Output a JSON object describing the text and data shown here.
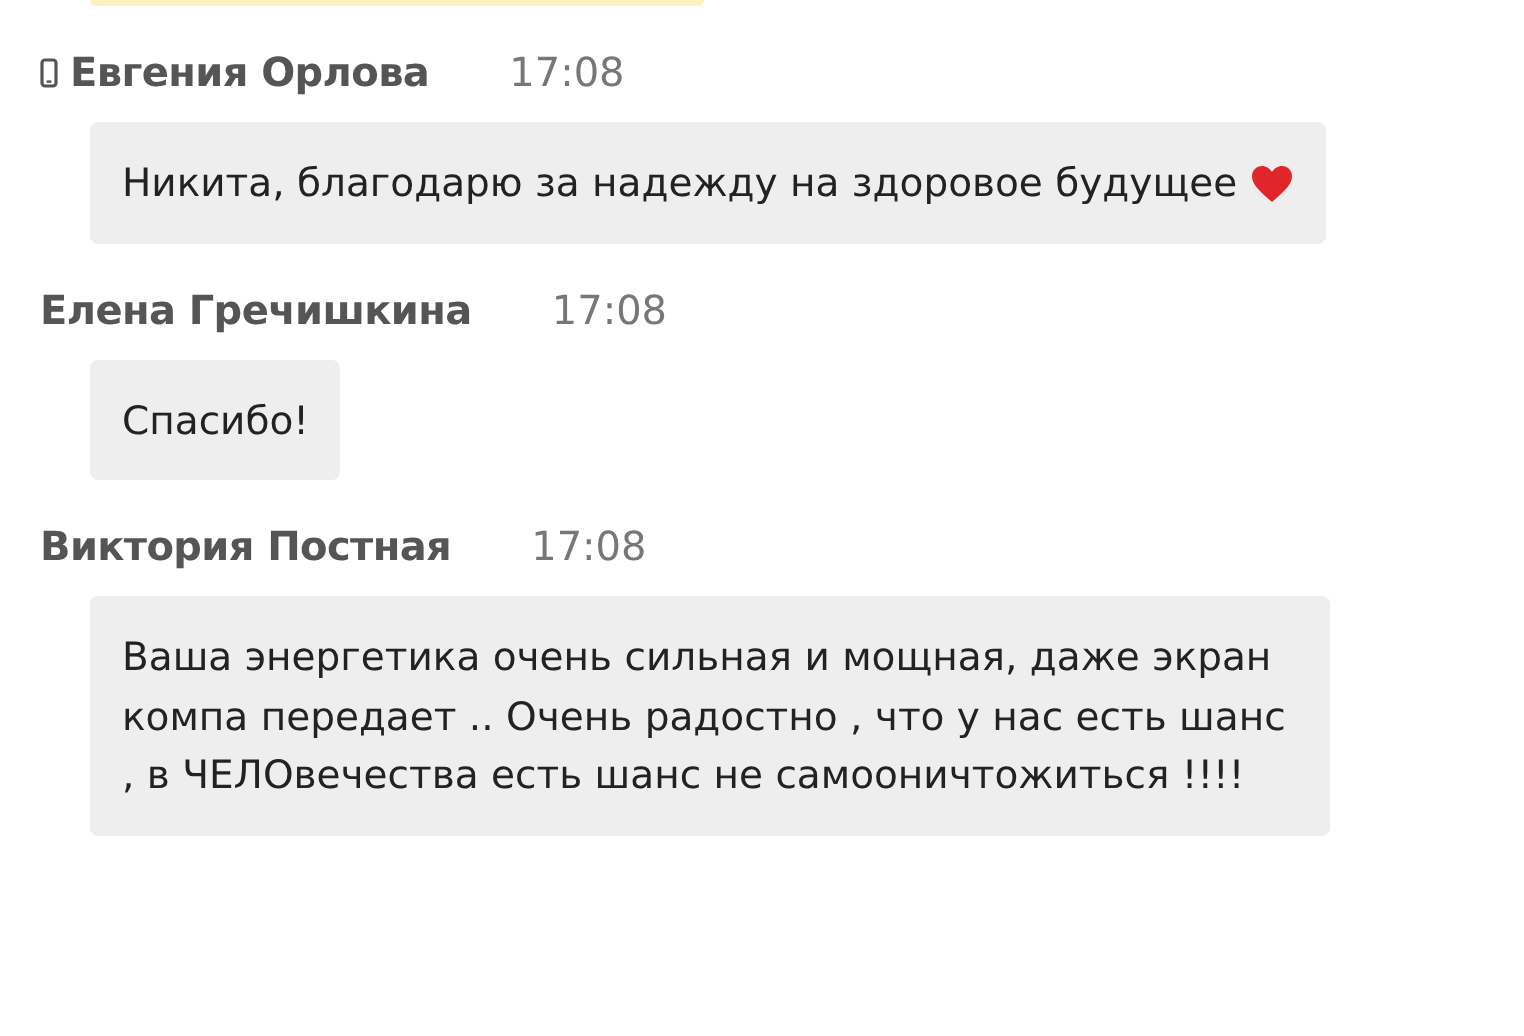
{
  "messages": [
    {
      "author": "Евгения Орлова",
      "time": "17:08",
      "mobile": true,
      "text": "Никита, благодарю за надежду на здоровое будущее",
      "heart": true
    },
    {
      "author": "Елена Гречишкина",
      "time": "17:08",
      "text": "Спасибо!"
    },
    {
      "author": "Виктория Постная",
      "time": "17:08",
      "text": "Ваша энергетика очень сильная и мощная, даже экран компа передает .. Очень радостно , что у нас есть шанс , в ЧЕЛОвечества есть шанс не самооничтожиться !!!!"
    }
  ]
}
